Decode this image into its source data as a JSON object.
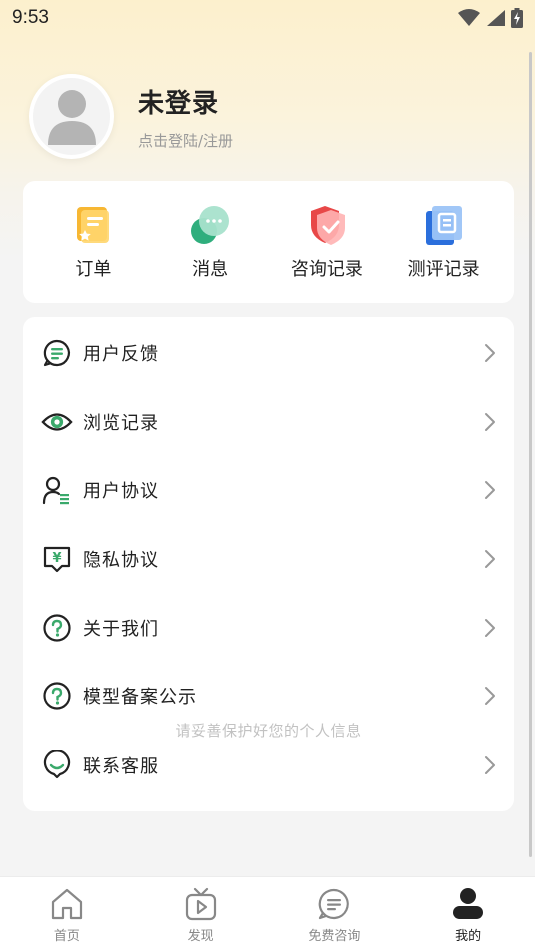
{
  "status_bar": {
    "time": "9:53"
  },
  "profile": {
    "name": "未登录",
    "subtitle": "点击登陆/注册"
  },
  "quick_actions": [
    {
      "label": "订单",
      "icon": "order-icon"
    },
    {
      "label": "消息",
      "icon": "message-icon"
    },
    {
      "label": "咨询记录",
      "icon": "consult-record-icon"
    },
    {
      "label": "测评记录",
      "icon": "assessment-record-icon"
    }
  ],
  "menu": [
    {
      "label": "用户反馈",
      "icon": "feedback-icon"
    },
    {
      "label": "浏览记录",
      "icon": "eye-icon"
    },
    {
      "label": "用户协议",
      "icon": "user-agreement-icon"
    },
    {
      "label": "隐私协议",
      "icon": "privacy-icon"
    },
    {
      "label": "关于我们",
      "icon": "question-icon"
    },
    {
      "label": "模型备案公示",
      "icon": "question-icon"
    },
    {
      "label": "联系客服",
      "icon": "customer-service-icon"
    }
  ],
  "privacy_hint": "请妥善保护好您的个人信息",
  "tabs": [
    {
      "label": "首页",
      "icon": "home-icon",
      "active": false
    },
    {
      "label": "发现",
      "icon": "tv-icon",
      "active": false
    },
    {
      "label": "免费咨询",
      "icon": "chat-icon",
      "active": false
    },
    {
      "label": "我的",
      "icon": "person-icon",
      "active": true
    }
  ],
  "colors": {
    "accent_green": "#3aa96b",
    "header_bg": "#fcf0cd"
  }
}
